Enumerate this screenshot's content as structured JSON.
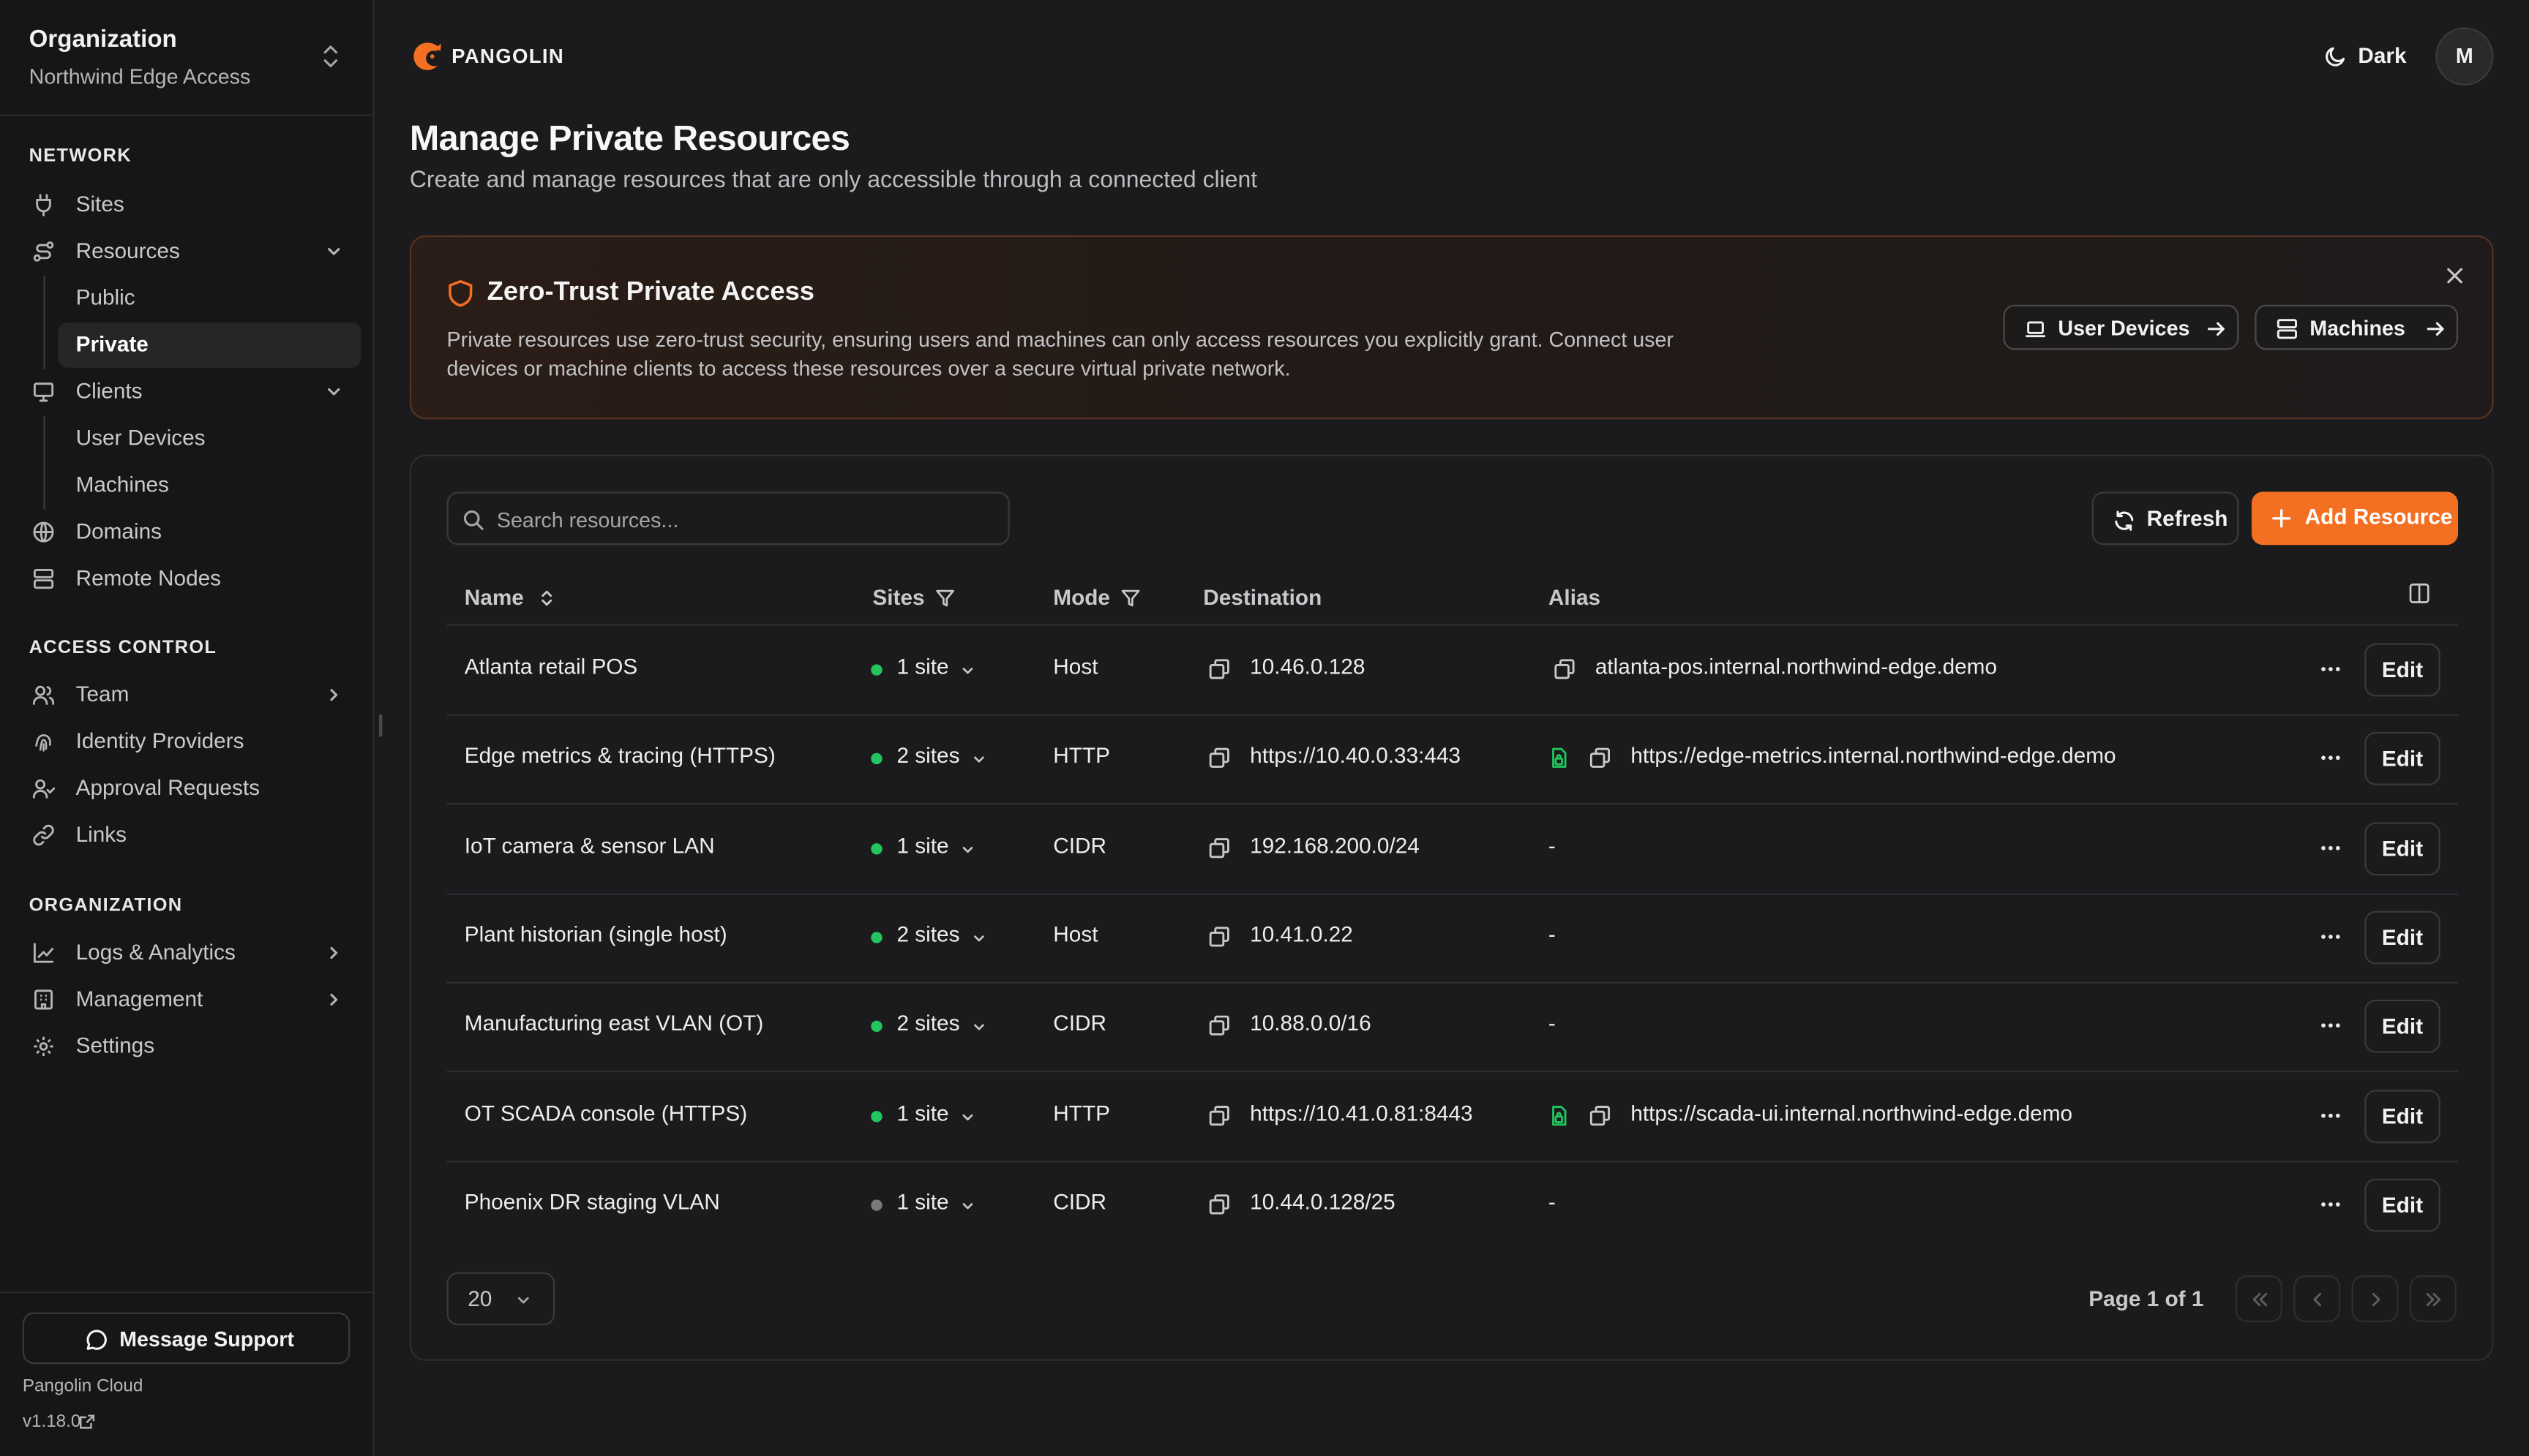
{
  "org": {
    "title": "Organization",
    "name": "Northwind Edge Access"
  },
  "nav": {
    "network_title": "NETWORK",
    "sites": "Sites",
    "resources": "Resources",
    "public": "Public",
    "private": "Private",
    "clients": "Clients",
    "user_devices": "User Devices",
    "machines": "Machines",
    "domains": "Domains",
    "remote_nodes": "Remote Nodes",
    "access_title": "ACCESS CONTROL",
    "team": "Team",
    "identity_providers": "Identity Providers",
    "approval_requests": "Approval Requests",
    "links": "Links",
    "organization_title": "ORGANIZATION",
    "logs": "Logs & Analytics",
    "management": "Management",
    "settings": "Settings"
  },
  "footer": {
    "message_support": "Message Support",
    "cloud": "Pangolin Cloud",
    "version": "v1.18.0"
  },
  "header": {
    "brand": "PANGOLIN",
    "theme": "Dark",
    "avatar": "M"
  },
  "page": {
    "title": "Manage Private Resources",
    "subtitle": "Create and manage resources that are only accessible through a connected client"
  },
  "banner": {
    "title": "Zero-Trust Private Access",
    "text": "Private resources use zero-trust security, ensuring users and machines can only access resources you explicitly grant. Connect user devices or machine clients to access these resources over a secure virtual private network.",
    "user_devices": "User Devices",
    "machines": "Machines"
  },
  "toolbar": {
    "search_placeholder": "Search resources...",
    "refresh": "Refresh",
    "add": "Add Resource"
  },
  "table": {
    "headers": {
      "name": "Name",
      "sites": "Sites",
      "mode": "Mode",
      "destination": "Destination",
      "alias": "Alias"
    },
    "edit_label": "Edit",
    "rows": [
      {
        "name": "Atlanta retail POS",
        "sites": "1 site",
        "online": true,
        "mode": "Host",
        "destination": "10.46.0.128",
        "alias": "atlanta-pos.internal.northwind-edge.demo",
        "alias_lock": false
      },
      {
        "name": "Edge metrics & tracing (HTTPS)",
        "sites": "2 sites",
        "online": true,
        "mode": "HTTP",
        "destination": "https://10.40.0.33:443",
        "alias": "https://edge-metrics.internal.northwind-edge.demo",
        "alias_lock": true
      },
      {
        "name": "IoT camera & sensor LAN",
        "sites": "1 site",
        "online": true,
        "mode": "CIDR",
        "destination": "192.168.200.0/24",
        "alias": "-",
        "alias_lock": false
      },
      {
        "name": "Plant historian (single host)",
        "sites": "2 sites",
        "online": true,
        "mode": "Host",
        "destination": "10.41.0.22",
        "alias": "-",
        "alias_lock": false
      },
      {
        "name": "Manufacturing east VLAN (OT)",
        "sites": "2 sites",
        "online": true,
        "mode": "CIDR",
        "destination": "10.88.0.0/16",
        "alias": "-",
        "alias_lock": false
      },
      {
        "name": "OT SCADA console (HTTPS)",
        "sites": "1 site",
        "online": true,
        "mode": "HTTP",
        "destination": "https://10.41.0.81:8443",
        "alias": "https://scada-ui.internal.northwind-edge.demo",
        "alias_lock": true
      },
      {
        "name": "Phoenix DR staging VLAN",
        "sites": "1 site",
        "online": false,
        "mode": "CIDR",
        "destination": "10.44.0.128/25",
        "alias": "-",
        "alias_lock": false
      }
    ]
  },
  "pagination": {
    "page_size": "20",
    "page_info": "Page 1 of 1"
  },
  "colors": {
    "accent": "#f36f21",
    "online": "#22c55e",
    "offline": "#7a7a7d",
    "background": "#1b1b1d",
    "sidebar": "#161617"
  },
  "icons": [
    "chevrons-up-down-icon",
    "plug-icon",
    "route-icon",
    "monitor-icon",
    "globe-icon",
    "server-icon",
    "users-icon",
    "fingerprint-icon",
    "user-check-icon",
    "link-icon",
    "chart-icon",
    "building-icon",
    "gear-icon",
    "message-icon",
    "moon-icon",
    "shield-icon",
    "laptop-icon",
    "refresh-icon",
    "plus-icon",
    "copy-icon",
    "lock-icon",
    "filter-icon",
    "columns-icon"
  ]
}
